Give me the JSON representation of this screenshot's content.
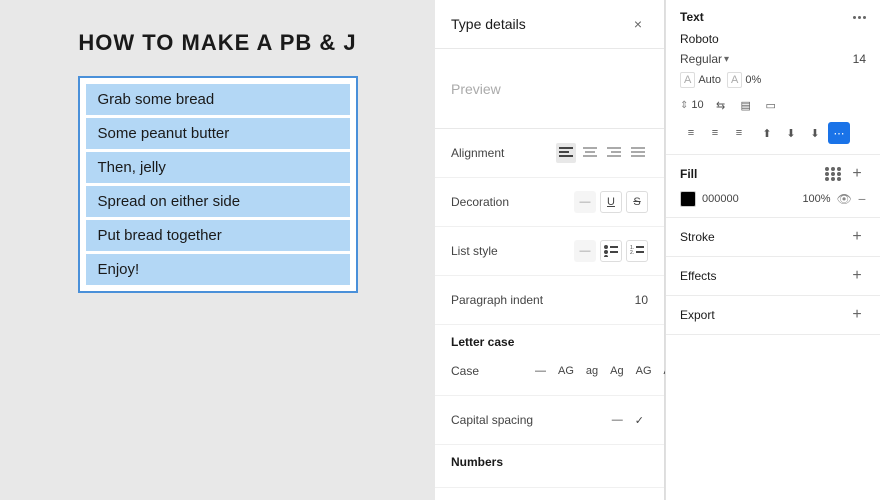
{
  "canvas": {
    "title": "HOW TO MAKE A PB & J",
    "list_items": [
      "Grab some bread",
      "Some peanut butter",
      "Then, jelly",
      "Spread on either side",
      "Put bread together",
      "Enjoy!"
    ]
  },
  "type_panel": {
    "title": "Type details",
    "close_label": "×",
    "preview_label": "Preview",
    "alignment": {
      "label": "Alignment",
      "options": [
        "≡",
        "≡",
        "≡",
        "≡"
      ]
    },
    "decoration": {
      "label": "Decoration",
      "dash": "—",
      "underline": "U",
      "strikethrough": "S"
    },
    "list_style": {
      "label": "List style",
      "dash": "—",
      "bullet": "•",
      "number": "1."
    },
    "paragraph_indent": {
      "label": "Paragraph indent",
      "value": "10"
    },
    "letter_case": {
      "title": "Letter case",
      "label": "Case",
      "options": [
        "—",
        "AG",
        "ag",
        "Ag",
        "AG",
        "AG"
      ]
    },
    "capital_spacing": {
      "label": "Capital spacing",
      "dash": "—",
      "check": "✓"
    },
    "numbers": {
      "title": "Numbers"
    }
  },
  "props_panel": {
    "text_section": {
      "title": "Text",
      "font_name": "Roboto",
      "font_style": "Regular",
      "font_size": "14",
      "auto_label": "Auto",
      "percent_label": "0%",
      "line_height": "10",
      "tracking_label": ""
    },
    "fill_section": {
      "title": "Fill",
      "color_hex": "000000",
      "opacity": "100%"
    },
    "stroke_section": {
      "title": "Stroke"
    },
    "effects_section": {
      "title": "Effects"
    },
    "export_section": {
      "title": "Export"
    }
  }
}
